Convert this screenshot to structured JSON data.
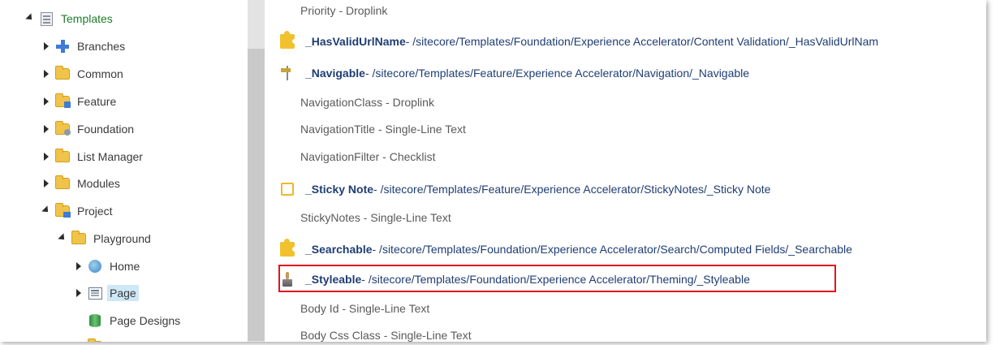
{
  "tree": {
    "items": [
      {
        "label": "Templates",
        "icon": "template-icon",
        "expanded": true
      },
      {
        "label": "Branches",
        "icon": "branch-icon",
        "expanded": false
      },
      {
        "label": "Common",
        "icon": "folder-icon",
        "expanded": false
      },
      {
        "label": "Feature",
        "icon": "feature-folder-icon",
        "expanded": false
      },
      {
        "label": "Foundation",
        "icon": "foundation-folder-icon",
        "expanded": false
      },
      {
        "label": "List Manager",
        "icon": "folder-icon",
        "expanded": false
      },
      {
        "label": "Modules",
        "icon": "folder-icon",
        "expanded": false
      },
      {
        "label": "Project",
        "icon": "project-folder-icon",
        "expanded": true
      },
      {
        "label": "Playground",
        "icon": "folder-icon",
        "expanded": true
      },
      {
        "label": "Home",
        "icon": "home-icon",
        "expanded": false
      },
      {
        "label": "Page",
        "icon": "page-template-icon",
        "expanded": false,
        "selected": true
      },
      {
        "label": "Page Designs",
        "icon": "page-designs-icon"
      }
    ]
  },
  "content": {
    "rows": [
      {
        "kind": "field",
        "text": "Priority - Droplink"
      },
      {
        "kind": "template",
        "icon": "puzzle-icon",
        "name": "_HasValidUrlName",
        "path": " - /sitecore/Templates/Foundation/Experience Accelerator/Content Validation/_HasValidUrlNam"
      },
      {
        "kind": "template",
        "icon": "signpost-icon",
        "name": "_Navigable",
        "path": " - /sitecore/Templates/Feature/Experience Accelerator/Navigation/_Navigable"
      },
      {
        "kind": "field",
        "text": "NavigationClass - Droplink"
      },
      {
        "kind": "field",
        "text": "NavigationTitle - Single-Line Text"
      },
      {
        "kind": "field",
        "text": "NavigationFilter - Checklist"
      },
      {
        "kind": "template",
        "icon": "sticky-note-icon",
        "name": "_Sticky Note",
        "path": " - /sitecore/Templates/Feature/Experience Accelerator/StickyNotes/_Sticky Note"
      },
      {
        "kind": "field",
        "text": "StickyNotes - Single-Line Text"
      },
      {
        "kind": "template",
        "icon": "puzzle-icon",
        "name": "_Searchable",
        "path": " - /sitecore/Templates/Foundation/Experience Accelerator/Search/Computed Fields/_Searchable"
      },
      {
        "kind": "template",
        "icon": "brush-icon",
        "name": "_Styleable",
        "path": " - /sitecore/Templates/Foundation/Experience Accelerator/Theming/_Styleable",
        "highlighted": true
      },
      {
        "kind": "field",
        "text": "Body Id - Single-Line Text"
      },
      {
        "kind": "field",
        "text": "Body Css Class - Single-Line Text"
      }
    ]
  },
  "colors": {
    "highlight_border": "#e0161b",
    "link_text": "#1f3d73",
    "selected_bg": "#cfe8f7",
    "tree_root_text": "#1e7d2b"
  }
}
